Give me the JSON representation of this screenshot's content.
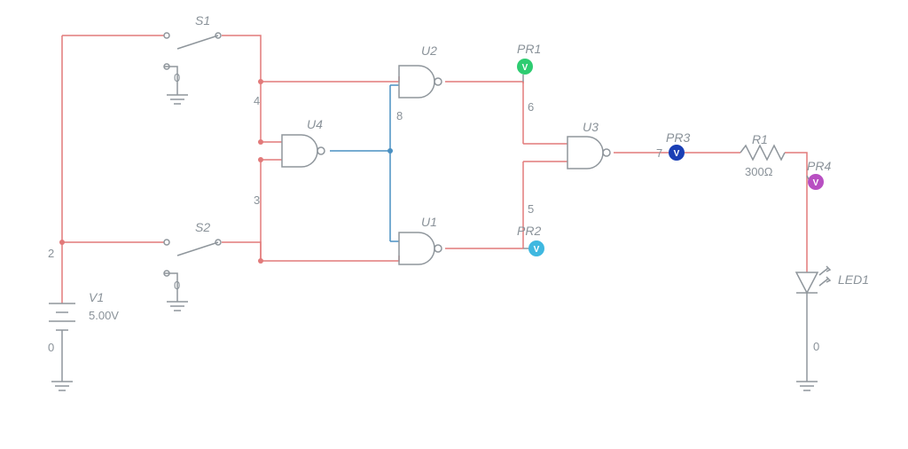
{
  "components": {
    "V1": {
      "label": "V1",
      "value": "5.00V"
    },
    "S1": {
      "label": "S1"
    },
    "S2": {
      "label": "S2"
    },
    "U1": {
      "label": "U1"
    },
    "U2": {
      "label": "U2"
    },
    "U3": {
      "label": "U3"
    },
    "U4": {
      "label": "U4"
    },
    "R1": {
      "label": "R1",
      "value": "300Ω"
    },
    "LED1": {
      "label": "LED1"
    }
  },
  "probes": {
    "PR1": {
      "label": "PR1",
      "glyph": "V",
      "color": "#2ecc71"
    },
    "PR2": {
      "label": "PR2",
      "glyph": "V",
      "color": "#3fb8e0"
    },
    "PR3": {
      "label": "PR3",
      "glyph": "V",
      "color": "#1a3fb5"
    },
    "PR4": {
      "label": "PR4",
      "glyph": "V",
      "color": "#b84fc2"
    }
  },
  "nodes": {
    "n0a": "0",
    "n0b": "0",
    "n0c": "0",
    "n0d": "0",
    "n2": "2",
    "n3": "3",
    "n4": "4",
    "n5": "5",
    "n6": "6",
    "n7": "7",
    "n8": "8"
  }
}
